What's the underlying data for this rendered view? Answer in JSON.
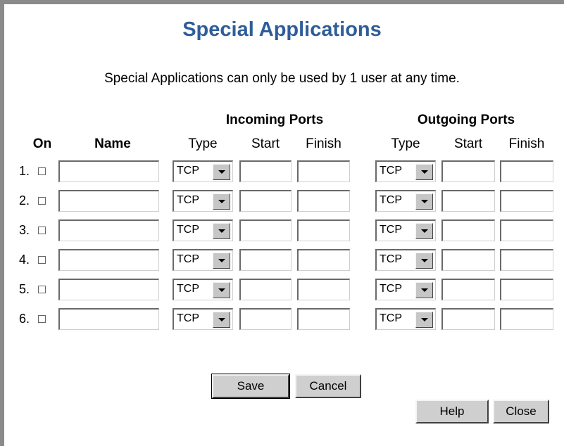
{
  "page": {
    "title": "Special Applications",
    "subtitle": "Special Applications can only be used by 1 user at any time."
  },
  "table": {
    "group_incoming": "Incoming Ports",
    "group_outgoing": "Outgoing Ports",
    "col_on": "On",
    "col_name": "Name",
    "col_type": "Type",
    "col_start": "Start",
    "col_finish": "Finish",
    "rows": [
      {
        "num": "1.",
        "on": false,
        "name": "",
        "in_type": "TCP",
        "in_start": "",
        "in_finish": "",
        "out_type": "TCP",
        "out_start": "",
        "out_finish": ""
      },
      {
        "num": "2.",
        "on": false,
        "name": "",
        "in_type": "TCP",
        "in_start": "",
        "in_finish": "",
        "out_type": "TCP",
        "out_start": "",
        "out_finish": ""
      },
      {
        "num": "3.",
        "on": false,
        "name": "",
        "in_type": "TCP",
        "in_start": "",
        "in_finish": "",
        "out_type": "TCP",
        "out_start": "",
        "out_finish": ""
      },
      {
        "num": "4.",
        "on": false,
        "name": "",
        "in_type": "TCP",
        "in_start": "",
        "in_finish": "",
        "out_type": "TCP",
        "out_start": "",
        "out_finish": ""
      },
      {
        "num": "5.",
        "on": false,
        "name": "",
        "in_type": "TCP",
        "in_start": "",
        "in_finish": "",
        "out_type": "TCP",
        "out_start": "",
        "out_finish": ""
      },
      {
        "num": "6.",
        "on": false,
        "name": "",
        "in_type": "TCP",
        "in_start": "",
        "in_finish": "",
        "out_type": "TCP",
        "out_start": "",
        "out_finish": ""
      }
    ]
  },
  "buttons": {
    "save": "Save",
    "cancel": "Cancel",
    "help": "Help",
    "close": "Close"
  },
  "colors": {
    "title": "#2f5d9a",
    "frame": "#8a8a8a",
    "button_face": "#cfcfcf"
  }
}
